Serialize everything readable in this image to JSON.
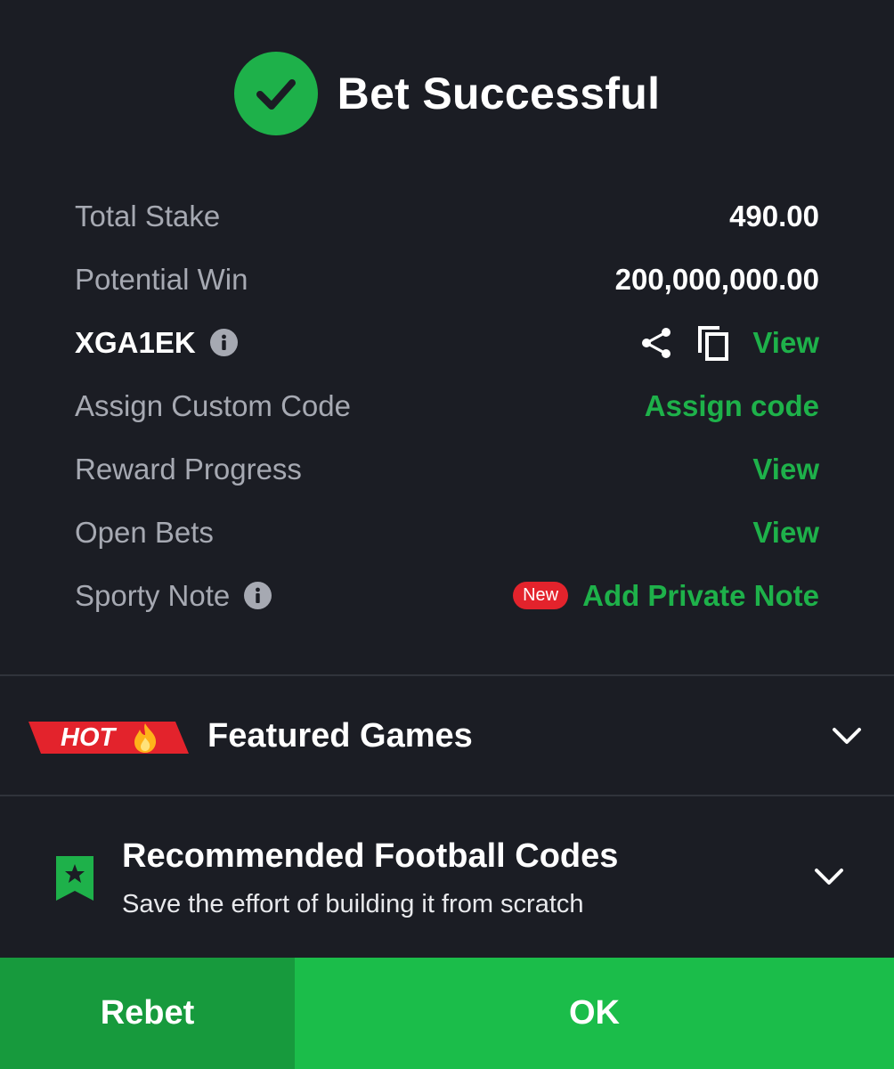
{
  "header": {
    "title": "Bet Successful"
  },
  "details": {
    "total_stake_label": "Total Stake",
    "total_stake_value": "490.00",
    "potential_win_label": "Potential Win",
    "potential_win_value": "200,000,000.00",
    "booking_code": "XGA1EK",
    "booking_view": "View",
    "custom_code_label": "Assign Custom Code",
    "custom_code_link": "Assign code",
    "reward_label": "Reward Progress",
    "reward_link": "View",
    "open_bets_label": "Open Bets",
    "open_bets_link": "View",
    "note_label": "Sporty Note",
    "note_badge": "New",
    "note_link": "Add Private Note"
  },
  "featured": {
    "badge": "HOT",
    "title": "Featured Games"
  },
  "recommended": {
    "title": "Recommended Football Codes",
    "subtitle": "Save the effort of building it from scratch"
  },
  "buttons": {
    "rebet": "Rebet",
    "ok": "OK"
  },
  "colors": {
    "background": "#1b1d24",
    "accent_green": "#1eb14a",
    "rebet_green": "#179a3d",
    "ok_green": "#1bbd4a",
    "hot_red": "#e3232c"
  },
  "icons": [
    "check-icon",
    "info-icon",
    "share-icon",
    "copy-icon",
    "fire-icon",
    "chevron-down-icon",
    "bookmark-star-icon"
  ]
}
